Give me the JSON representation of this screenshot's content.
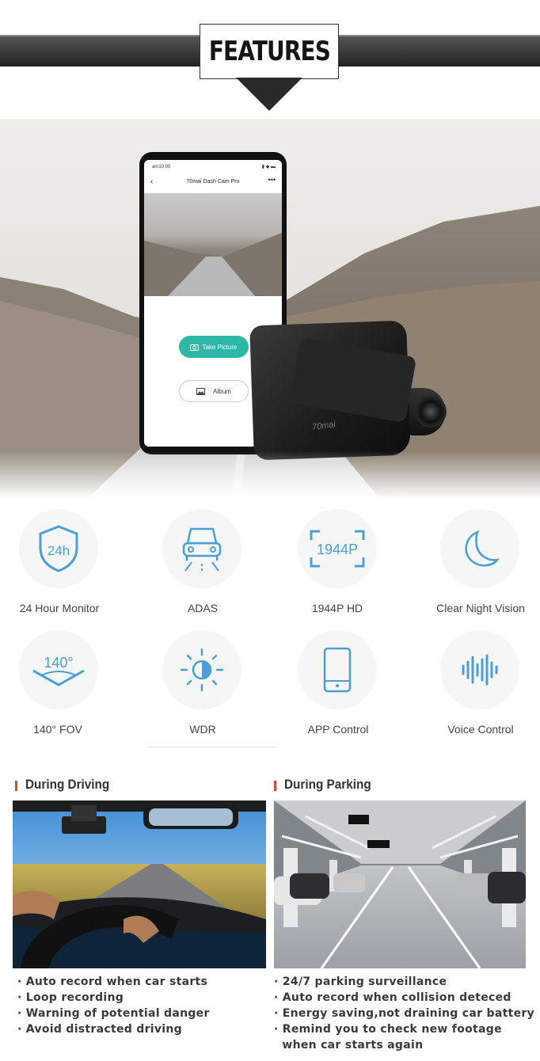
{
  "header": {
    "title": "FEATURES"
  },
  "phone": {
    "time": "am10:00",
    "status_icons": "▮ ◆ ▬",
    "app_title": "70mai Dash Cam Pro",
    "back": "‹",
    "more": "•••",
    "take_picture": "Take Picture",
    "album": "Album"
  },
  "camera": {
    "brand": "70mai"
  },
  "features": [
    {
      "label": "24 Hour Monitor",
      "icon": "shield-24h-icon",
      "badge": "24h"
    },
    {
      "label": "ADAS",
      "icon": "car-icon"
    },
    {
      "label": "1944P HD",
      "icon": "resolution-icon",
      "badge": "1944P"
    },
    {
      "label": "Clear Night Vision",
      "icon": "moon-icon"
    },
    {
      "label": "140° FOV",
      "icon": "field-of-view-icon",
      "badge": "140°"
    },
    {
      "label": "WDR",
      "icon": "sun-icon"
    },
    {
      "label": "APP Control",
      "icon": "phone-icon"
    },
    {
      "label": "Voice Control",
      "icon": "soundwave-icon"
    }
  ],
  "colors": {
    "accent": "#4a9fd8",
    "teal": "#2db8a6",
    "section_mark": "#e0462e"
  },
  "sections": {
    "driving": {
      "title": "During Driving",
      "bullets": [
        "· Auto record when car starts",
        "· Loop recording",
        "· Warning of potential danger",
        "· Avoid distracted driving"
      ]
    },
    "parking": {
      "title": "During Parking",
      "bullets": [
        "· 24/7 parking surveillance",
        "· Auto record when collision deteced",
        "· Energy saving,not draining car battery",
        "· Remind you to check new footage",
        "  when car starts again"
      ]
    }
  }
}
